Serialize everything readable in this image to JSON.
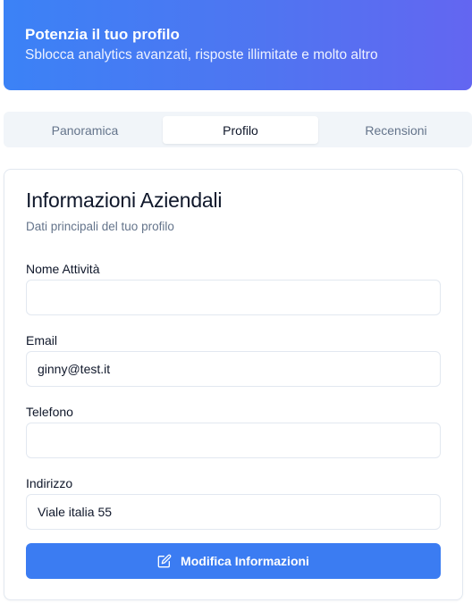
{
  "banner": {
    "title": "Potenzia il tuo profilo",
    "subtitle": "Sblocca analytics avanzati, risposte illimitate e molto altro"
  },
  "tabs": [
    {
      "label": "Panoramica",
      "active": false
    },
    {
      "label": "Profilo",
      "active": true
    },
    {
      "label": "Recensioni",
      "active": false
    }
  ],
  "card": {
    "title": "Informazioni Aziendali",
    "subtitle": "Dati principali del tuo profilo",
    "fields": [
      {
        "label": "Nome Attività",
        "value": ""
      },
      {
        "label": "Email",
        "value": "ginny@test.it"
      },
      {
        "label": "Telefono",
        "value": ""
      },
      {
        "label": "Indirizzo",
        "value": "Viale italia 55"
      }
    ],
    "button": {
      "label": "Modifica Informazioni",
      "icon": "edit-icon"
    }
  },
  "colors": {
    "accent": "#3b7cf2",
    "banner_start": "#3b82f6",
    "banner_end": "#6366f1"
  }
}
